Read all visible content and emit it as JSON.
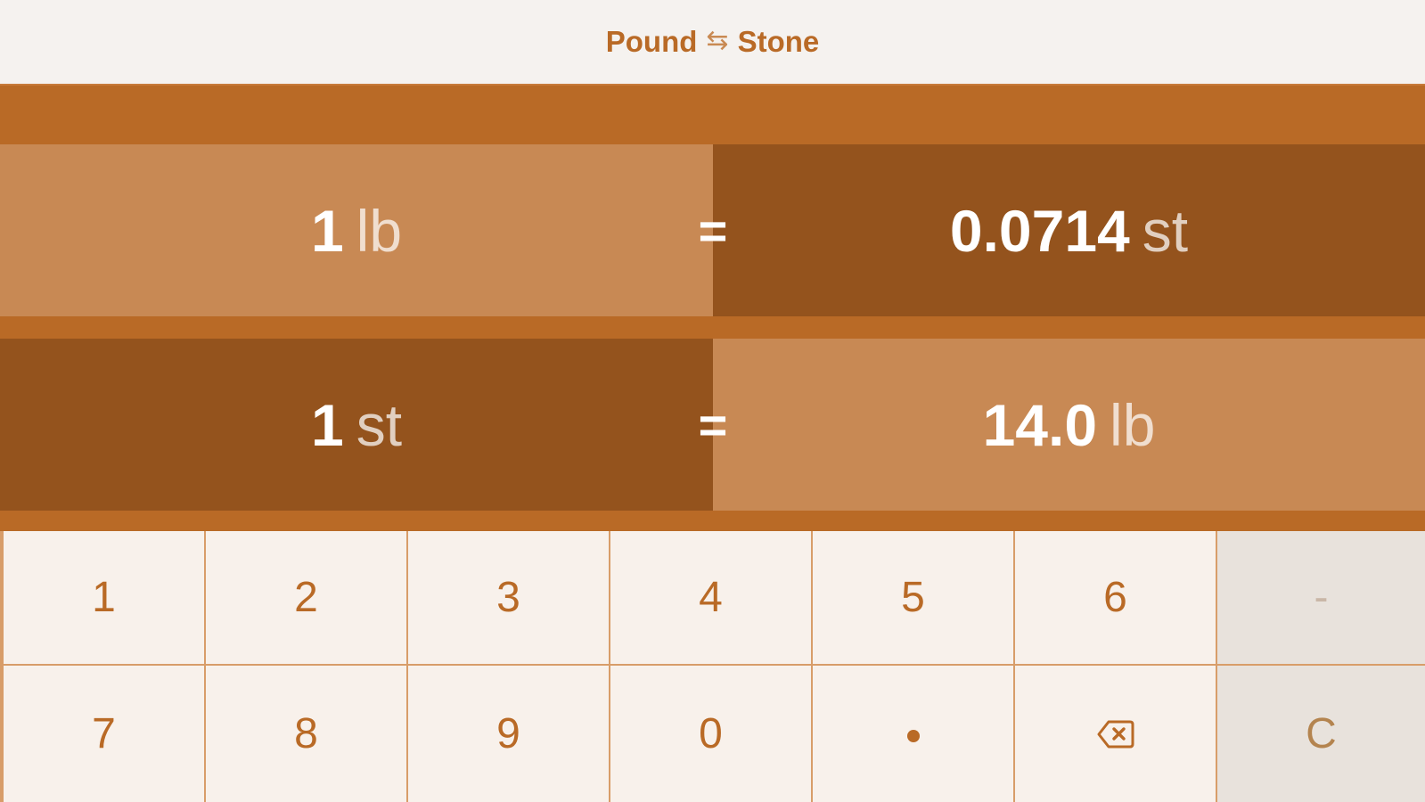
{
  "header": {
    "title_left": "Pound",
    "swap_symbol": "⇆",
    "title_right": "Stone"
  },
  "conversions": [
    {
      "from_value": "1",
      "from_unit": "lb",
      "equals": "=",
      "to_value": "0.0714",
      "to_unit": "st"
    },
    {
      "from_value": "1",
      "from_unit": "st",
      "equals": "=",
      "to_value": "14.0",
      "to_unit": "lb"
    }
  ],
  "keypad": {
    "row1": [
      "1",
      "2",
      "3",
      "4",
      "5",
      "6",
      "-"
    ],
    "row2": [
      "7",
      "8",
      "9",
      "0",
      "•",
      "backspace",
      "C"
    ]
  },
  "colors": {
    "accent": "#b96a26",
    "light_cell": "#c88954",
    "dark_cell": "#94531d",
    "key_bg": "#f8f1eb",
    "side_key_bg": "#e8e2dc"
  }
}
